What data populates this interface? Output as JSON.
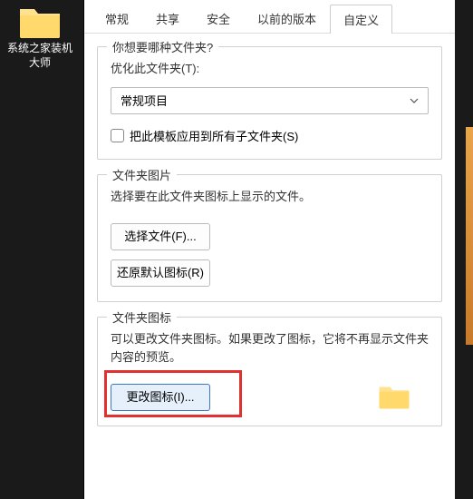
{
  "desktop": {
    "icon_label": "系统之家装机大师"
  },
  "tabs": [
    {
      "label": "常规"
    },
    {
      "label": "共享"
    },
    {
      "label": "安全"
    },
    {
      "label": "以前的版本"
    },
    {
      "label": "自定义",
      "active": true
    }
  ],
  "group1": {
    "title": "你想要哪种文件夹?",
    "optimize_label": "优化此文件夹(T):",
    "select_value": "常规项目",
    "apply_subfolders": "把此模板应用到所有子文件夹(S)"
  },
  "group2": {
    "title": "文件夹图片",
    "desc": "选择要在此文件夹图标上显示的文件。",
    "choose_file": "选择文件(F)...",
    "restore_default": "还原默认图标(R)"
  },
  "group3": {
    "title": "文件夹图标",
    "desc": "可以更改文件夹图标。如果更改了图标，它将不再显示文件夹内容的预览。",
    "change_icon": "更改图标(I)..."
  }
}
